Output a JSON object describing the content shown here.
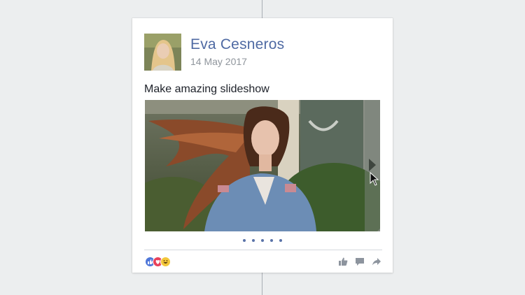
{
  "post": {
    "author_name": "Eva Cesneros",
    "date": "14 May 2017",
    "text": "Make amazing slideshow"
  },
  "slideshow": {
    "slide_count": 5,
    "next_icon": "chevron-right-icon"
  },
  "reactions": [
    "like-reaction-icon",
    "love-reaction-icon",
    "haha-reaction-icon"
  ],
  "actions": [
    "thumbs-up-icon",
    "comment-icon",
    "share-icon"
  ],
  "colors": {
    "background": "#eceeef",
    "name": "#4f6aa3",
    "dots": "#5a73a8"
  }
}
